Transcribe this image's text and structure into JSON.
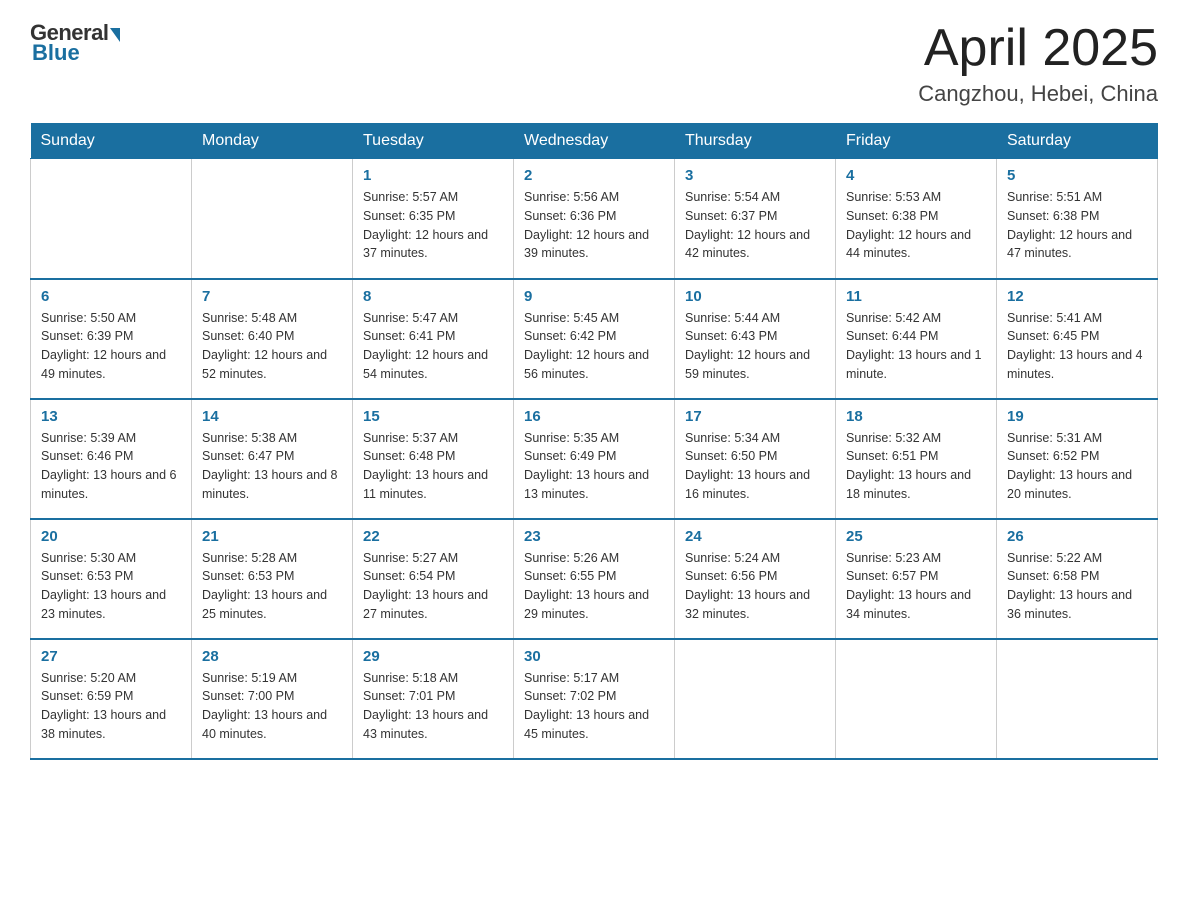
{
  "header": {
    "logo_general": "General",
    "logo_blue": "Blue",
    "title": "April 2025",
    "subtitle": "Cangzhou, Hebei, China"
  },
  "days_of_week": [
    "Sunday",
    "Monday",
    "Tuesday",
    "Wednesday",
    "Thursday",
    "Friday",
    "Saturday"
  ],
  "weeks": [
    [
      {
        "day": "",
        "info": ""
      },
      {
        "day": "",
        "info": ""
      },
      {
        "day": "1",
        "info": "Sunrise: 5:57 AM\nSunset: 6:35 PM\nDaylight: 12 hours\nand 37 minutes."
      },
      {
        "day": "2",
        "info": "Sunrise: 5:56 AM\nSunset: 6:36 PM\nDaylight: 12 hours\nand 39 minutes."
      },
      {
        "day": "3",
        "info": "Sunrise: 5:54 AM\nSunset: 6:37 PM\nDaylight: 12 hours\nand 42 minutes."
      },
      {
        "day": "4",
        "info": "Sunrise: 5:53 AM\nSunset: 6:38 PM\nDaylight: 12 hours\nand 44 minutes."
      },
      {
        "day": "5",
        "info": "Sunrise: 5:51 AM\nSunset: 6:38 PM\nDaylight: 12 hours\nand 47 minutes."
      }
    ],
    [
      {
        "day": "6",
        "info": "Sunrise: 5:50 AM\nSunset: 6:39 PM\nDaylight: 12 hours\nand 49 minutes."
      },
      {
        "day": "7",
        "info": "Sunrise: 5:48 AM\nSunset: 6:40 PM\nDaylight: 12 hours\nand 52 minutes."
      },
      {
        "day": "8",
        "info": "Sunrise: 5:47 AM\nSunset: 6:41 PM\nDaylight: 12 hours\nand 54 minutes."
      },
      {
        "day": "9",
        "info": "Sunrise: 5:45 AM\nSunset: 6:42 PM\nDaylight: 12 hours\nand 56 minutes."
      },
      {
        "day": "10",
        "info": "Sunrise: 5:44 AM\nSunset: 6:43 PM\nDaylight: 12 hours\nand 59 minutes."
      },
      {
        "day": "11",
        "info": "Sunrise: 5:42 AM\nSunset: 6:44 PM\nDaylight: 13 hours\nand 1 minute."
      },
      {
        "day": "12",
        "info": "Sunrise: 5:41 AM\nSunset: 6:45 PM\nDaylight: 13 hours\nand 4 minutes."
      }
    ],
    [
      {
        "day": "13",
        "info": "Sunrise: 5:39 AM\nSunset: 6:46 PM\nDaylight: 13 hours\nand 6 minutes."
      },
      {
        "day": "14",
        "info": "Sunrise: 5:38 AM\nSunset: 6:47 PM\nDaylight: 13 hours\nand 8 minutes."
      },
      {
        "day": "15",
        "info": "Sunrise: 5:37 AM\nSunset: 6:48 PM\nDaylight: 13 hours\nand 11 minutes."
      },
      {
        "day": "16",
        "info": "Sunrise: 5:35 AM\nSunset: 6:49 PM\nDaylight: 13 hours\nand 13 minutes."
      },
      {
        "day": "17",
        "info": "Sunrise: 5:34 AM\nSunset: 6:50 PM\nDaylight: 13 hours\nand 16 minutes."
      },
      {
        "day": "18",
        "info": "Sunrise: 5:32 AM\nSunset: 6:51 PM\nDaylight: 13 hours\nand 18 minutes."
      },
      {
        "day": "19",
        "info": "Sunrise: 5:31 AM\nSunset: 6:52 PM\nDaylight: 13 hours\nand 20 minutes."
      }
    ],
    [
      {
        "day": "20",
        "info": "Sunrise: 5:30 AM\nSunset: 6:53 PM\nDaylight: 13 hours\nand 23 minutes."
      },
      {
        "day": "21",
        "info": "Sunrise: 5:28 AM\nSunset: 6:53 PM\nDaylight: 13 hours\nand 25 minutes."
      },
      {
        "day": "22",
        "info": "Sunrise: 5:27 AM\nSunset: 6:54 PM\nDaylight: 13 hours\nand 27 minutes."
      },
      {
        "day": "23",
        "info": "Sunrise: 5:26 AM\nSunset: 6:55 PM\nDaylight: 13 hours\nand 29 minutes."
      },
      {
        "day": "24",
        "info": "Sunrise: 5:24 AM\nSunset: 6:56 PM\nDaylight: 13 hours\nand 32 minutes."
      },
      {
        "day": "25",
        "info": "Sunrise: 5:23 AM\nSunset: 6:57 PM\nDaylight: 13 hours\nand 34 minutes."
      },
      {
        "day": "26",
        "info": "Sunrise: 5:22 AM\nSunset: 6:58 PM\nDaylight: 13 hours\nand 36 minutes."
      }
    ],
    [
      {
        "day": "27",
        "info": "Sunrise: 5:20 AM\nSunset: 6:59 PM\nDaylight: 13 hours\nand 38 minutes."
      },
      {
        "day": "28",
        "info": "Sunrise: 5:19 AM\nSunset: 7:00 PM\nDaylight: 13 hours\nand 40 minutes."
      },
      {
        "day": "29",
        "info": "Sunrise: 5:18 AM\nSunset: 7:01 PM\nDaylight: 13 hours\nand 43 minutes."
      },
      {
        "day": "30",
        "info": "Sunrise: 5:17 AM\nSunset: 7:02 PM\nDaylight: 13 hours\nand 45 minutes."
      },
      {
        "day": "",
        "info": ""
      },
      {
        "day": "",
        "info": ""
      },
      {
        "day": "",
        "info": ""
      }
    ]
  ]
}
